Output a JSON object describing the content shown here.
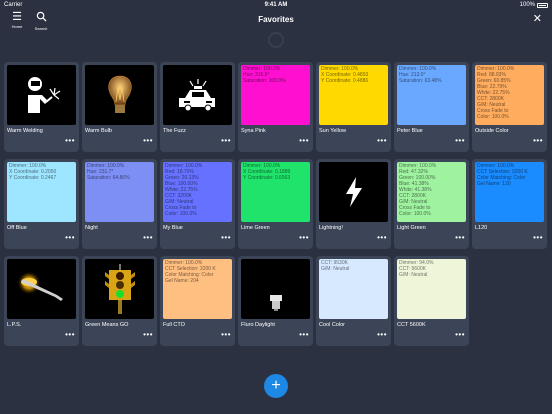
{
  "status_bar": {
    "carrier": "Carrier",
    "time": "9:41 AM",
    "battery": "100%"
  },
  "header": {
    "title": "Favorites",
    "home_label": "Home",
    "search_label": "Search"
  },
  "cards": [
    {
      "name": "Warm Welding",
      "icon": "welder-icon",
      "color": "#000000",
      "info": ""
    },
    {
      "name": "Warm Bulb",
      "icon": "lightbulb-icon",
      "color": "#000000",
      "info": ""
    },
    {
      "name": "The Fuzz",
      "icon": "police-car-icon",
      "color": "#000000",
      "info": ""
    },
    {
      "name": "Syna Pink",
      "icon": "",
      "color": "#ff0fd0",
      "info": "Dimmer: 100.0%\nHue: 315.0°\nSaturation: 100.0%"
    },
    {
      "name": "Sun Yellow",
      "icon": "",
      "color": "#ffd900",
      "info": "Dimmer: 100.0%\nX Coordinate: 0.4893\nY Coordinate: 0.4886"
    },
    {
      "name": "Peter Blue",
      "icon": "",
      "color": "#6aa8ff",
      "info": "Dimmer: 100.0%\nHue: 213.0°\nSaturation: 63.48%"
    },
    {
      "name": "Outside Color",
      "icon": "",
      "color": "#ffac5e",
      "info": "Dimmer: 100.0%\nRed: 88.93%\nGreen: 60.85%\nBlue: 22.79%\nWhite: 22.75%\nCCT: 2800K\nG/M: Neutral\nCross Fade to\nColor: 100.0%"
    },
    {
      "name": "Off Blue",
      "icon": "",
      "color": "#9ee6ff",
      "info": "Dimmer: 100.0%\nX Coordinate: 0.2050\nY Coordinate: 0.2467"
    },
    {
      "name": "Night",
      "icon": "",
      "color": "#7d8ff5",
      "info": "Dimmer: 100.0%\nHue: 231.7°\nSaturation: 64.86%"
    },
    {
      "name": "My Blue",
      "icon": "",
      "color": "#6672ff",
      "info": "Dimmer: 100.0%\nRed: 18.70%\nGreen: 20.13%\nBlue: 100.00%\nWhite: 22.75%\nCCT: 3200K\nG/M: Neutral\nCross Fade to\nColor: 100.0%"
    },
    {
      "name": "Lime Green",
      "icon": "",
      "color": "#1fe36a",
      "info": "Dimmer: 100.0%\nX Coordinate: 0.1889\nY Coordinate: 0.6563"
    },
    {
      "name": "Lightning!",
      "icon": "lightning-icon",
      "color": "#000000",
      "info": ""
    },
    {
      "name": "Light Green",
      "icon": "",
      "color": "#9ef2a0",
      "info": "Dimmer: 100.0%\nRed: 47.32%\nGreen: 100.00%\nBlue: 41.38%\nWhite: 41.38%\nCCT: 2800K\nG/M: Neutral\nCross Fade to\nColor: 100.0%"
    },
    {
      "name": "L120",
      "icon": "",
      "color": "#1a8cff",
      "info": "Dimmer: 100.0%\nCCT Selection: 3200 K\nColor Matching: Color\nGel Name: 120"
    },
    {
      "name": "L.P.S.",
      "icon": "street-lamp-icon",
      "color": "#000000",
      "info": ""
    },
    {
      "name": "Green Means GO",
      "icon": "traffic-light-icon",
      "color": "#000000",
      "info": ""
    },
    {
      "name": "Full CTO",
      "icon": "",
      "color": "#ffbf80",
      "info": "Dimmer: 100.0%\nCCT Selection: 3200 K\nColor Matching: Color\nGel Name: 204"
    },
    {
      "name": "Fluro Daylight",
      "icon": "cfl-bulb-icon",
      "color": "#000000",
      "info": ""
    },
    {
      "name": "Cool Color",
      "icon": "",
      "color": "#d6e9ff",
      "info": "CCT: 9530K\nG/M: Neutral"
    },
    {
      "name": "CCT 5600K",
      "icon": "",
      "color": "#eef5d9",
      "info": "Dimmer: 94.0%\nCCT: 5600K\nG/M: Neutral"
    }
  ],
  "more_label": "•••",
  "fab_label": "+"
}
